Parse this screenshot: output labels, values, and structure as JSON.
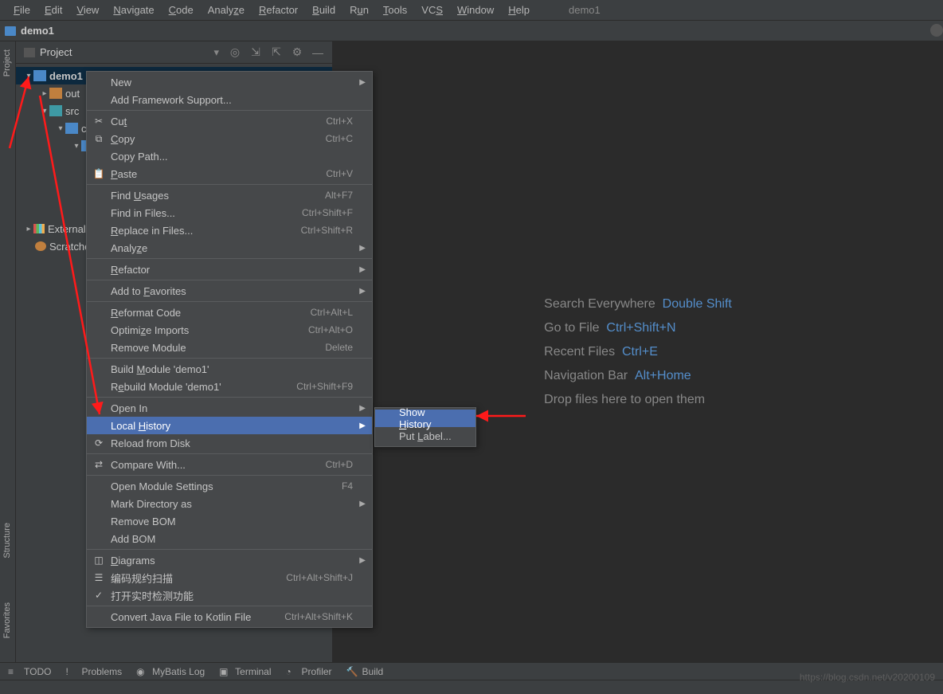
{
  "menubar": {
    "items": [
      "File",
      "Edit",
      "View",
      "Navigate",
      "Code",
      "Analyze",
      "Refactor",
      "Build",
      "Run",
      "Tools",
      "VCS",
      "Window",
      "Help"
    ],
    "title": "demo1"
  },
  "breadcrumb": {
    "project": "demo1"
  },
  "project_panel": {
    "title": "Project",
    "tree": {
      "root": "demo1",
      "out": "out",
      "src": "src",
      "co": "co",
      "external": "External Libraries",
      "scratches": "Scratche"
    }
  },
  "welcome": {
    "r1_label": "Search Everywhere",
    "r1_sc": "Double Shift",
    "r2_label": "Go to File",
    "r2_sc": "Ctrl+Shift+N",
    "r3_label": "Recent Files",
    "r3_sc": "Ctrl+E",
    "r4_label": "Navigation Bar",
    "r4_sc": "Alt+Home",
    "r5_label": "Drop files here to open them"
  },
  "context_menu": [
    {
      "label": "New",
      "sub": true
    },
    {
      "label": "Add Framework Support..."
    },
    {
      "sep": true
    },
    {
      "icon": "✂",
      "label": "Cut",
      "u": "t",
      "sc": "Ctrl+X"
    },
    {
      "icon": "⧉",
      "label": "Copy",
      "u": "C",
      "sc": "Ctrl+C"
    },
    {
      "label": "Copy Path..."
    },
    {
      "icon": "📋",
      "label": "Paste",
      "u": "P",
      "sc": "Ctrl+V"
    },
    {
      "sep": true
    },
    {
      "label": "Find Usages",
      "u": "U",
      "sc": "Alt+F7"
    },
    {
      "label": "Find in Files...",
      "sc": "Ctrl+Shift+F"
    },
    {
      "label": "Replace in Files...",
      "u": "R",
      "sc": "Ctrl+Shift+R"
    },
    {
      "label": "Analyze",
      "u": "z",
      "sub": true
    },
    {
      "sep": true
    },
    {
      "label": "Refactor",
      "u": "R",
      "sub": true
    },
    {
      "sep": true
    },
    {
      "label": "Add to Favorites",
      "u": "F",
      "sub": true
    },
    {
      "sep": true
    },
    {
      "label": "Reformat Code",
      "u": "R",
      "sc": "Ctrl+Alt+L"
    },
    {
      "label": "Optimize Imports",
      "u": "z",
      "sc": "Ctrl+Alt+O"
    },
    {
      "label": "Remove Module",
      "sc": "Delete"
    },
    {
      "sep": true
    },
    {
      "label": "Build Module 'demo1'",
      "u": "M"
    },
    {
      "label": "Rebuild Module 'demo1'",
      "u": "e",
      "sc": "Ctrl+Shift+F9"
    },
    {
      "sep": true
    },
    {
      "label": "Open In",
      "sub": true
    },
    {
      "label": "Local History",
      "u": "H",
      "sub": true,
      "hl": true
    },
    {
      "icon": "⟳",
      "label": "Reload from Disk"
    },
    {
      "sep": true
    },
    {
      "icon": "⇄",
      "label": "Compare With...",
      "sc": "Ctrl+D"
    },
    {
      "sep": true
    },
    {
      "label": "Open Module Settings",
      "sc": "F4"
    },
    {
      "label": "Mark Directory as",
      "sub": true
    },
    {
      "label": "Remove BOM"
    },
    {
      "label": "Add BOM"
    },
    {
      "sep": true
    },
    {
      "icon": "◫",
      "label": "Diagrams",
      "u": "D",
      "sub": true
    },
    {
      "icon": "☰",
      "label": "编码规约扫描",
      "sc": "Ctrl+Alt+Shift+J"
    },
    {
      "icon": "✓",
      "label": "打开实时检测功能"
    },
    {
      "sep": true
    },
    {
      "label": "Convert Java File to Kotlin File",
      "sc": "Ctrl+Alt+Shift+K"
    }
  ],
  "submenu": [
    {
      "label": "Show History",
      "u": "H",
      "hl": true
    },
    {
      "label": "Put Label...",
      "u": "L"
    }
  ],
  "bottombar": {
    "items": [
      {
        "icon": "≡",
        "label": "TODO"
      },
      {
        "icon": "!",
        "label": "Problems"
      },
      {
        "icon": "◉",
        "label": "MyBatis Log"
      },
      {
        "icon": "▣",
        "label": "Terminal"
      },
      {
        "icon": "◔",
        "label": "Profiler"
      },
      {
        "icon": "🔨",
        "label": "Build"
      }
    ]
  },
  "sidebar_labels": {
    "project": "Project",
    "structure": "Structure",
    "favorites": "Favorites"
  },
  "watermark": "https://blog.csdn.net/v20200109"
}
